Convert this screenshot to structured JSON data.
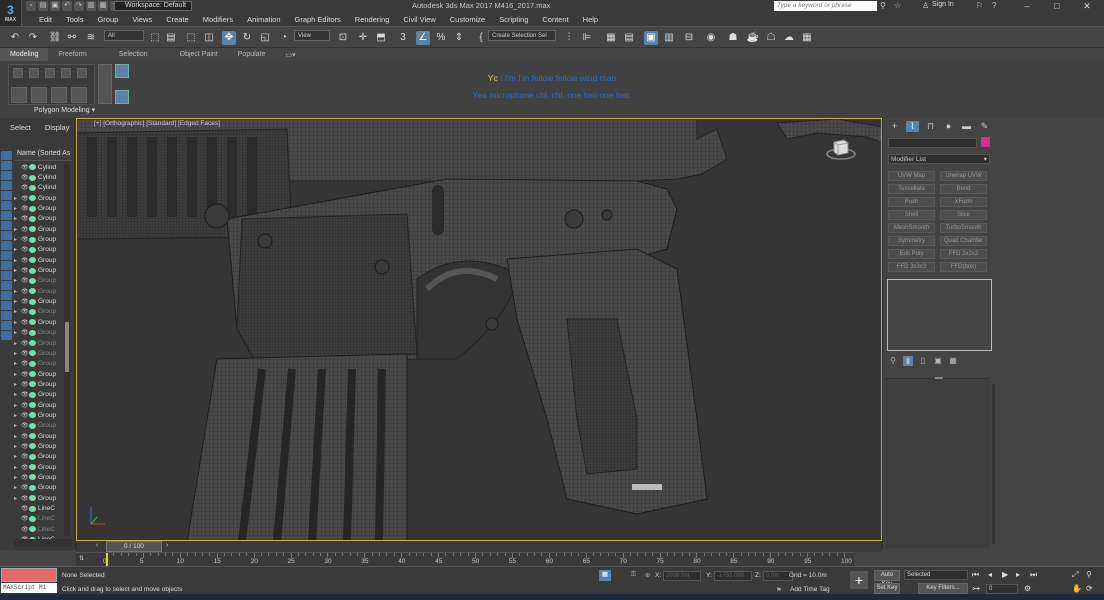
{
  "app": {
    "logo": "3",
    "logo_sub": "MAX",
    "title": "Autodesk 3ds Max 2017     M416_2017.max",
    "workspace": "Workspace: Default",
    "search_placeholder": "Type a keyword or phrase",
    "sign_in": "Sign In"
  },
  "menu": [
    "Edit",
    "Tools",
    "Group",
    "Views",
    "Create",
    "Modifiers",
    "Animation",
    "Graph Editors",
    "Rendering",
    "Civil View",
    "Customize",
    "Scripting",
    "Content",
    "Help"
  ],
  "toolbar": {
    "filter": "All",
    "refcoord": "View",
    "selection_set": "Create Selection Sel"
  },
  "ribbon": {
    "tabs": [
      "Modeling",
      "Freeform",
      "Selection",
      "Object Paint",
      "Populate"
    ],
    "active": "Modeling",
    "group_label": "Polygon Modeling"
  },
  "subtitles": {
    "line1_prefix": "Yc",
    "line1": "I I'm I'm fellow fellow wind man",
    "line2": "Yea microphone chl. chl. one two one two."
  },
  "scene_explorer": {
    "tabs": [
      "Select",
      "Display"
    ],
    "column": "Name (Sorted As",
    "rows": [
      {
        "name": "Cylind",
        "arrow": false,
        "dim": false
      },
      {
        "name": "Cylind",
        "arrow": false,
        "dim": false
      },
      {
        "name": "Cylind",
        "arrow": false,
        "dim": false
      },
      {
        "name": "Group",
        "arrow": true,
        "dim": false
      },
      {
        "name": "Group",
        "arrow": true,
        "dim": false
      },
      {
        "name": "Group",
        "arrow": true,
        "dim": false
      },
      {
        "name": "Group",
        "arrow": true,
        "dim": false
      },
      {
        "name": "Group",
        "arrow": true,
        "dim": false
      },
      {
        "name": "Group",
        "arrow": true,
        "dim": false
      },
      {
        "name": "Group",
        "arrow": true,
        "dim": false
      },
      {
        "name": "Group",
        "arrow": true,
        "dim": false
      },
      {
        "name": "Group",
        "arrow": true,
        "dim": true
      },
      {
        "name": "Group",
        "arrow": true,
        "dim": true
      },
      {
        "name": "Group",
        "arrow": true,
        "dim": false
      },
      {
        "name": "Group",
        "arrow": true,
        "dim": true
      },
      {
        "name": "Group",
        "arrow": true,
        "dim": false
      },
      {
        "name": "Group",
        "arrow": true,
        "dim": true
      },
      {
        "name": "Group",
        "arrow": true,
        "dim": true
      },
      {
        "name": "Group",
        "arrow": true,
        "dim": true
      },
      {
        "name": "Group",
        "arrow": true,
        "dim": true
      },
      {
        "name": "Group",
        "arrow": true,
        "dim": false
      },
      {
        "name": "Group",
        "arrow": true,
        "dim": false
      },
      {
        "name": "Group",
        "arrow": true,
        "dim": false
      },
      {
        "name": "Group",
        "arrow": true,
        "dim": false
      },
      {
        "name": "Group",
        "arrow": true,
        "dim": false
      },
      {
        "name": "Group",
        "arrow": true,
        "dim": true
      },
      {
        "name": "Group",
        "arrow": true,
        "dim": false
      },
      {
        "name": "Group",
        "arrow": true,
        "dim": false
      },
      {
        "name": "Group",
        "arrow": true,
        "dim": false
      },
      {
        "name": "Group",
        "arrow": true,
        "dim": false
      },
      {
        "name": "Group",
        "arrow": true,
        "dim": false
      },
      {
        "name": "Group",
        "arrow": true,
        "dim": false
      },
      {
        "name": "Group",
        "arrow": true,
        "dim": false
      },
      {
        "name": "LineC",
        "arrow": false,
        "dim": false
      },
      {
        "name": "LineC",
        "arrow": false,
        "dim": true
      },
      {
        "name": "LineC",
        "arrow": false,
        "dim": true
      },
      {
        "name": "LineC",
        "arrow": false,
        "dim": false
      }
    ]
  },
  "viewport": {
    "label": "[+] [Orthographic] [Standard] [Edged Faces]"
  },
  "command_panel": {
    "modifier_list": "Modifier List",
    "buttons": [
      "UVW Map",
      "Unwrap UVW",
      "Tessellate",
      "Bend",
      "Push",
      "XForm",
      "Shell",
      "Slice",
      "MeshSmooth",
      "TurboSmooth",
      "Symmetry",
      "Quad Chamfer",
      "Edit Poly",
      "FFD 2x2x2",
      "FFD 3x3x3",
      "FFD(box)"
    ]
  },
  "timeline": {
    "frame": "0 / 100",
    "ticks": [
      "0",
      "5",
      "10",
      "15",
      "20",
      "25",
      "30",
      "35",
      "40",
      "45",
      "50",
      "55",
      "60",
      "65",
      "70",
      "75",
      "80",
      "85",
      "90",
      "95",
      "100"
    ]
  },
  "status": {
    "maxscript": "MAXScript Mi",
    "selection": "None Selected",
    "prompt": "Click and drag to select and move objects",
    "x": "2038.0m",
    "y": "-1752.088",
    "z": "0.0m",
    "grid": "Grid = 10.0m",
    "add_time_tag": "Add Time Tag",
    "auto_key": "Auto Key",
    "set_key": "Set Key",
    "selected": "Selected",
    "key_filters": "Key Filters...",
    "frame_value": "0"
  }
}
